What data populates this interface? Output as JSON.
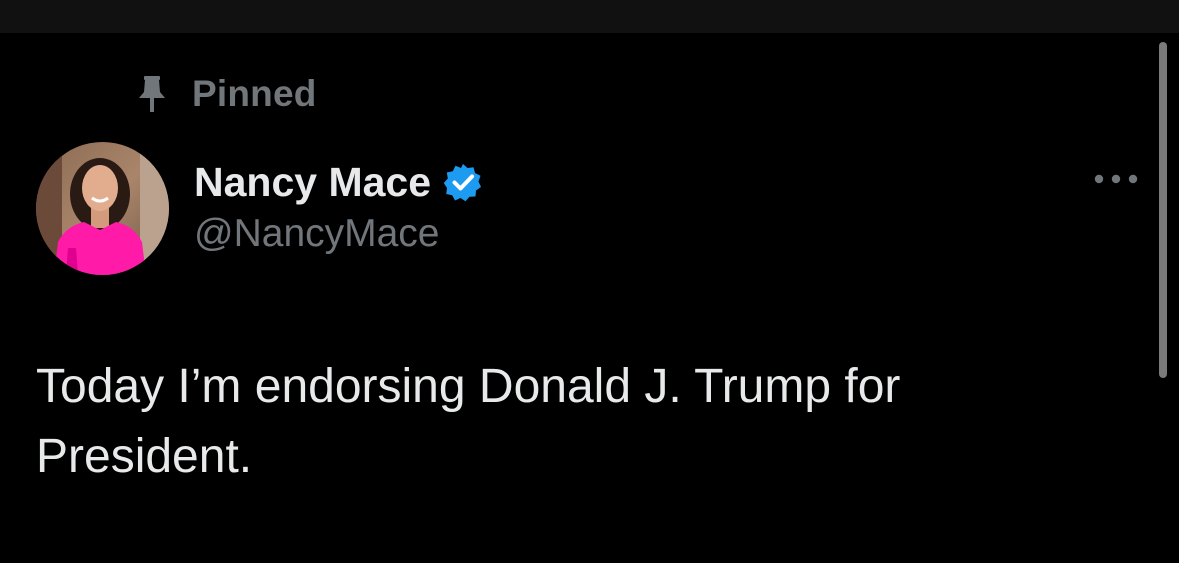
{
  "colors": {
    "background": "#000000",
    "text_primary": "#e7e9ea",
    "text_secondary": "#71767b",
    "verified_blue": "#1d9bf0"
  },
  "pinned": {
    "icon": "pin-icon",
    "label": "Pinned"
  },
  "tweet": {
    "author": {
      "display_name": "Nancy Mace",
      "verified_icon": "verified-badge-icon",
      "handle": "@NancyMace",
      "avatar": "avatar-photo"
    },
    "more_icon": "more-options-icon",
    "text": "Today I’m endorsing Donald J. Trump for\nPresident."
  }
}
